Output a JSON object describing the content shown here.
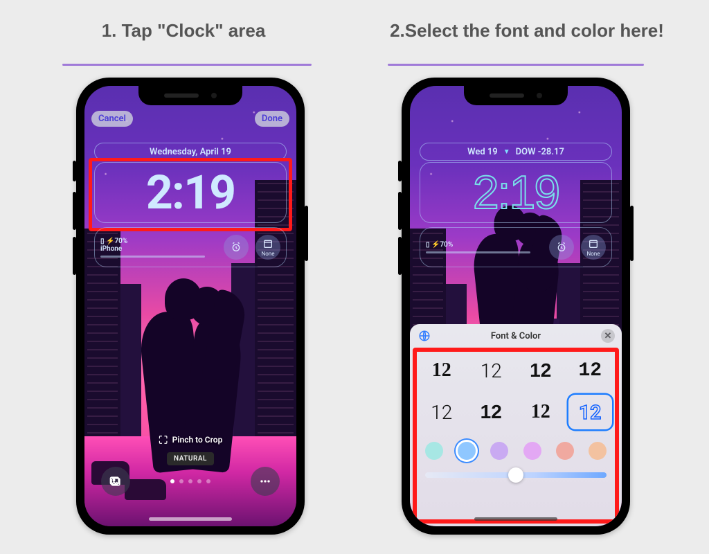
{
  "steps": {
    "step1": "1. Tap \"Clock\" area",
    "step2": "2.Select the font and color here!"
  },
  "accent": "#a07ad8",
  "highlight": "#ff1a1a",
  "phone1": {
    "cancel": "Cancel",
    "done": "Done",
    "date": "Wednesday, April 19",
    "clock": "2:19",
    "battery_line": "⚡70%",
    "battery_device": "iPhone",
    "widget_none": "None",
    "pinch": "Pinch to Crop",
    "mode_pill": "NATURAL"
  },
  "phone2": {
    "date_short": "Wed 19",
    "ticker": "DOW -28.17",
    "clock": "2:19",
    "battery_line": "⚡70%",
    "widget_none": "None",
    "sheet_title": "Font & Color",
    "font_sample": "12",
    "font_options": [
      {
        "style": "regular"
      },
      {
        "style": "thin"
      },
      {
        "style": "heavy"
      },
      {
        "style": "mono"
      },
      {
        "style": "thin"
      },
      {
        "style": "heavy"
      },
      {
        "style": "regular"
      },
      {
        "style": "outline",
        "selected": true
      }
    ],
    "colors": [
      {
        "hex": "#a7e7e4"
      },
      {
        "hex": "#8fc7ff",
        "selected": true
      },
      {
        "hex": "#c9aaf2"
      },
      {
        "hex": "#e3a8f4"
      },
      {
        "hex": "#f0a9a0"
      },
      {
        "hex": "#f3c2a0"
      }
    ],
    "slider_value": 0.5
  }
}
